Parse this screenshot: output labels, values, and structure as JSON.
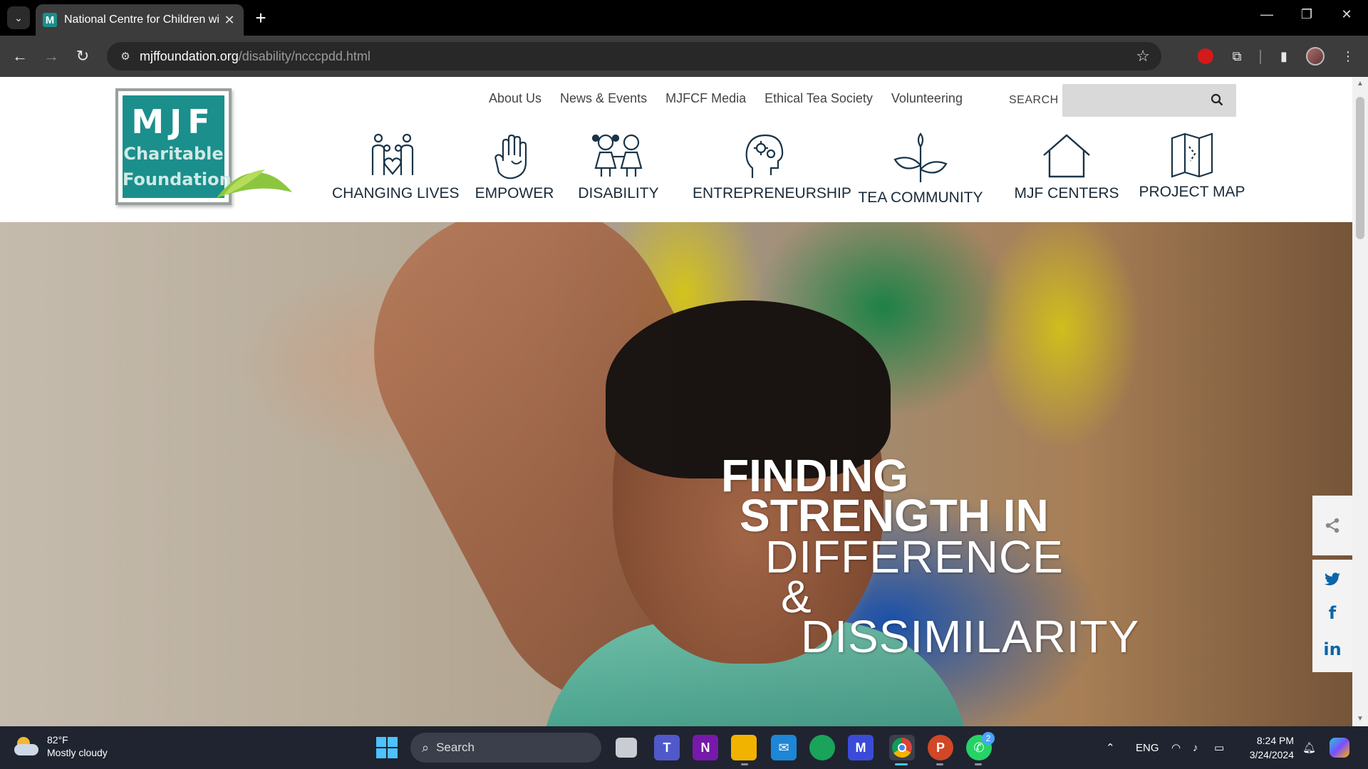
{
  "browser": {
    "tab_title": "National Centre for Children wi",
    "tab_favicon_letter": "M",
    "new_tab_label": "+",
    "url_domain": "mjffoundation.org",
    "url_path": "/disability/ncccpdd.html"
  },
  "site": {
    "logo": {
      "title": "MJF",
      "line1": "Charitable",
      "line2": "Foundation"
    },
    "top_nav": [
      "About Us",
      "News & Events",
      "MJFCF Media",
      "Ethical Tea Society",
      "Volunteering"
    ],
    "search_label": "SEARCH",
    "search_placeholder": "",
    "main_nav": [
      {
        "label": "CHANGING LIVES",
        "icon": "family-heart-icon"
      },
      {
        "label": "EMPOWER",
        "icon": "hand-icon"
      },
      {
        "label": "DISABILITY",
        "icon": "children-icon"
      },
      {
        "label": "ENTREPRENEURSHIP",
        "icon": "head-gears-icon"
      },
      {
        "label": "TEA COMMUNITY",
        "icon": "tea-leaf-icon"
      },
      {
        "label": "MJF CENTERS",
        "icon": "house-icon"
      },
      {
        "label": "PROJECT MAP",
        "icon": "map-icon"
      }
    ],
    "hero": {
      "line1": "FINDING",
      "line2": "STRENGTH IN",
      "line3": "DIFFERENCE",
      "line4": "&",
      "line5": "DISSIMILARITY"
    },
    "social": [
      {
        "icon": "share-icon"
      },
      {
        "icon": "twitter-icon"
      },
      {
        "icon": "facebook-icon",
        "glyph": "f"
      },
      {
        "icon": "linkedin-icon",
        "glyph": "in"
      }
    ],
    "colors": {
      "brand_teal": "#1b8f8c",
      "nav_text": "#1a2a38",
      "social_blue": "#0a66a8"
    }
  },
  "taskbar": {
    "weather_temp": "82°F",
    "weather_desc": "Mostly cloudy",
    "search_label": "Search",
    "language": "ENG",
    "time": "8:24 PM",
    "date": "3/24/2024",
    "whatsapp_badge": "2"
  }
}
